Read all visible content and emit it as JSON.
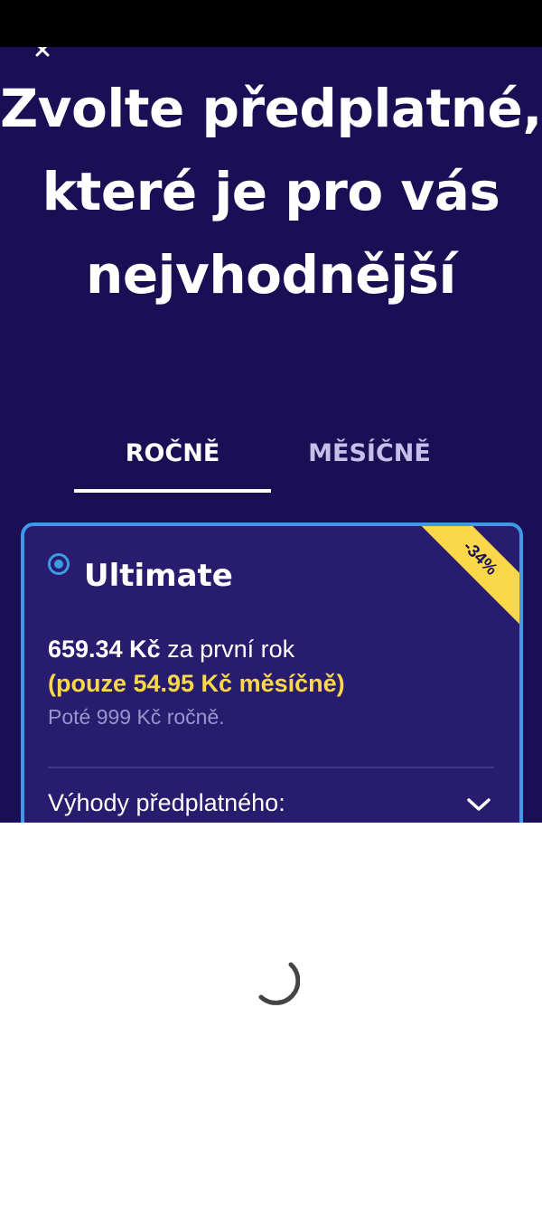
{
  "headline": "Zvolte předplatné, které je pro vás nejvhodnější",
  "tabs": {
    "yearly": "ROČNĚ",
    "monthly": "MĚSÍČNĚ",
    "selected": "yearly"
  },
  "plan": {
    "name": "Ultimate",
    "badge": "-34%",
    "price_amount": "659.34 Kč",
    "price_suffix": "za první rok",
    "monthly_note": "(pouze 54.95 Kč měsíčně)",
    "renewal_note": "Poté 999 Kč ročně.",
    "benefits_label": "Výhody předplatného:",
    "selected": true
  },
  "icons": {
    "close": "close-icon",
    "chevron": "chevron-down-icon",
    "radio": "radio-selected-icon",
    "spinner": "loading-spinner-icon"
  },
  "colors": {
    "background": "#1a0f54",
    "card": "#271c6d",
    "accent_blue": "#3d9ae6",
    "accent_yellow": "#fbd84a",
    "muted_text": "#9c95cc"
  }
}
